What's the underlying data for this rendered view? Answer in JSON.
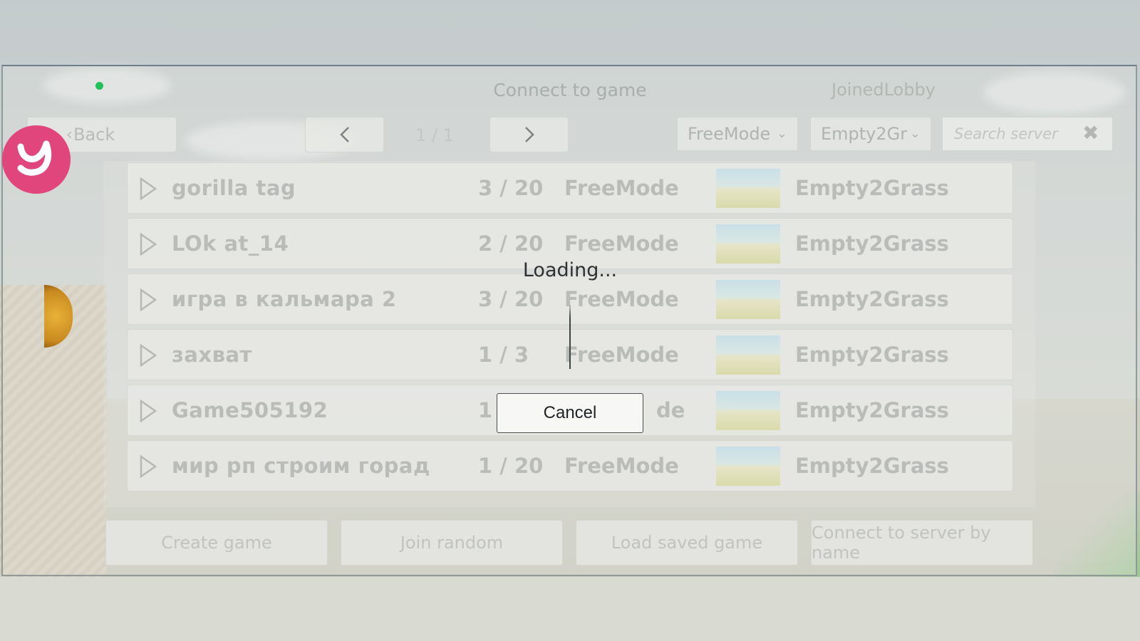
{
  "window": {
    "title": "Connect to game",
    "lobby_status": "JoinedLobby"
  },
  "nav": {
    "back_label": "Back",
    "prev_icon": "chevron-left-icon",
    "next_icon": "chevron-right-icon",
    "page": "1 / 1"
  },
  "filters": {
    "mode": "FreeMode",
    "map": "Empty2Gr",
    "search_placeholder": "Search server",
    "clear_icon": "close-icon"
  },
  "servers": [
    {
      "name": "gorilla tag",
      "players": "3 / 20",
      "mode": "FreeMode",
      "map": "Empty2Grass"
    },
    {
      "name": "LOk at_14",
      "players": "2 / 20",
      "mode": "FreeMode",
      "map": "Empty2Grass"
    },
    {
      "name": "игра в кальмара 2",
      "players": "3 / 20",
      "mode": "FreeMode",
      "map": "Empty2Grass"
    },
    {
      "name": "захват",
      "players": "1 / 3",
      "mode": "FreeMode",
      "map": "Empty2Grass"
    },
    {
      "name": "Game505192",
      "players": "1",
      "mode": "de",
      "map": "Empty2Grass"
    },
    {
      "name": "мир рп строим горад",
      "players": "1 / 20",
      "mode": "FreeMode",
      "map": "Empty2Grass"
    }
  ],
  "actions": {
    "create": "Create game",
    "join_random": "Join random",
    "load_saved": "Load saved game",
    "connect_by_name": "Connect to server by name"
  },
  "loading": {
    "text": "Loading...",
    "cancel": "Cancel"
  },
  "colors": {
    "status_dot": "#22c05a",
    "logo_bg": "#e0457b"
  }
}
